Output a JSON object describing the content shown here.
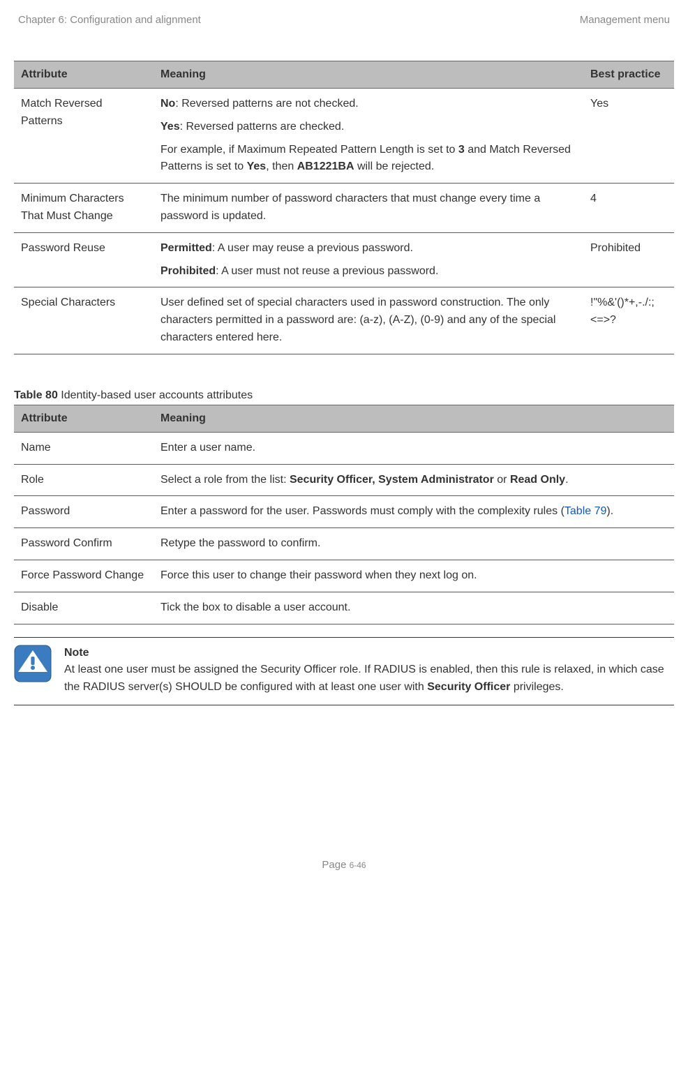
{
  "header": {
    "left": "Chapter 6:  Configuration and alignment",
    "right": "Management menu"
  },
  "table79": {
    "headers": {
      "attr": "Attribute",
      "meaning": "Meaning",
      "best": "Best practice"
    },
    "rows": [
      {
        "attr": "Match Reversed Patterns",
        "m_no_b": "No",
        "m_no_t": ": Reversed patterns are not checked.",
        "m_yes_b": "Yes",
        "m_yes_t": ": Reversed patterns are checked.",
        "m_ex_pre": "For example, if Maximum Repeated Pattern Length is set to ",
        "m_ex_b1": "3",
        "m_ex_mid": " and Match Reversed Patterns is set to ",
        "m_ex_b2": "Yes",
        "m_ex_mid2": ", then ",
        "m_ex_b3": "AB1221BA",
        "m_ex_tail": " will be rejected.",
        "best": "Yes"
      },
      {
        "attr": "Minimum Characters That Must Change",
        "meaning": "The minimum number of password characters that must change every time a password is updated.",
        "best": "4"
      },
      {
        "attr": "Password Reuse",
        "m_b1": "Permitted",
        "m_t1": ": A user may reuse a previous password.",
        "m_b2": "Prohibited",
        "m_t2": ": A user must not reuse a previous password.",
        "best": "Prohibited"
      },
      {
        "attr": "Special Characters",
        "meaning": "User defined set of special characters used in password construction. The only characters permitted in a password are: (a-z), (A-Z), (0-9) and any of the special characters entered here.",
        "best": "!\"%&'()*+,-./:;<=>?"
      }
    ]
  },
  "table80": {
    "caption_b": "Table 80",
    "caption_t": "  Identity-based user accounts attributes",
    "headers": {
      "attr": "Attribute",
      "meaning": "Meaning"
    },
    "rows": [
      {
        "attr": "Name",
        "meaning": "Enter a user name."
      },
      {
        "attr": "Role",
        "m_pre": "Select a role from the list: ",
        "m_b1": "Security Officer, System Administrator",
        "m_mid": " or ",
        "m_b2": "Read Only",
        "m_tail": "."
      },
      {
        "attr": "Password",
        "m_pre": "Enter a password for the user. Passwords must comply with the complexity rules (",
        "m_link": "Table 79",
        "m_tail": ")."
      },
      {
        "attr": "Password Confirm",
        "meaning": "Retype the password to confirm."
      },
      {
        "attr": "Force Password Change",
        "meaning": "Force this user to change their password when they next log on."
      },
      {
        "attr": "Disable",
        "meaning": "Tick the box to disable a user account."
      }
    ]
  },
  "note": {
    "title": "Note",
    "t1": "At least one user must be assigned the Security Officer role. If RADIUS is enabled, then this rule is relaxed, in which case the RADIUS server(s) SHOULD be configured with at least one user with ",
    "b": "Security Officer",
    "t2": " privileges."
  },
  "footer": {
    "page_label": "Page ",
    "page_num": "6-46"
  }
}
